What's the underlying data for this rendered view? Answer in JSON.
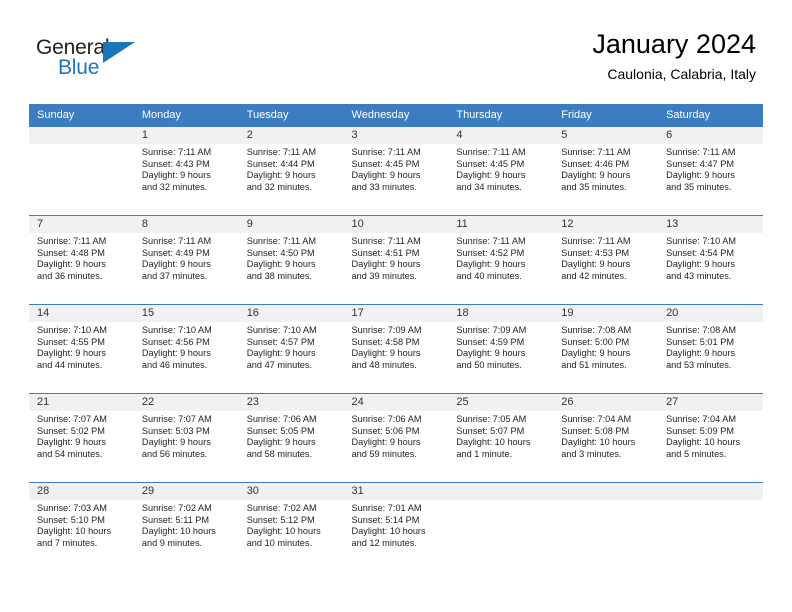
{
  "brand": {
    "name_part1": "General",
    "name_part2": "Blue",
    "accent_color": "#1b76bc"
  },
  "header": {
    "title": "January 2024",
    "subtitle": "Caulonia, Calabria, Italy"
  },
  "theme": {
    "header_band": "#3b7dc0",
    "daynum_band": "#f1f1f1",
    "text": "#231f20"
  },
  "weekdays": [
    "Sunday",
    "Monday",
    "Tuesday",
    "Wednesday",
    "Thursday",
    "Friday",
    "Saturday"
  ],
  "weeks": [
    [
      {
        "day": ""
      },
      {
        "day": "1",
        "sunrise": "Sunrise: 7:11 AM",
        "sunset": "Sunset: 4:43 PM",
        "daylight_1": "Daylight: 9 hours",
        "daylight_2": "and 32 minutes."
      },
      {
        "day": "2",
        "sunrise": "Sunrise: 7:11 AM",
        "sunset": "Sunset: 4:44 PM",
        "daylight_1": "Daylight: 9 hours",
        "daylight_2": "and 32 minutes."
      },
      {
        "day": "3",
        "sunrise": "Sunrise: 7:11 AM",
        "sunset": "Sunset: 4:45 PM",
        "daylight_1": "Daylight: 9 hours",
        "daylight_2": "and 33 minutes."
      },
      {
        "day": "4",
        "sunrise": "Sunrise: 7:11 AM",
        "sunset": "Sunset: 4:45 PM",
        "daylight_1": "Daylight: 9 hours",
        "daylight_2": "and 34 minutes."
      },
      {
        "day": "5",
        "sunrise": "Sunrise: 7:11 AM",
        "sunset": "Sunset: 4:46 PM",
        "daylight_1": "Daylight: 9 hours",
        "daylight_2": "and 35 minutes."
      },
      {
        "day": "6",
        "sunrise": "Sunrise: 7:11 AM",
        "sunset": "Sunset: 4:47 PM",
        "daylight_1": "Daylight: 9 hours",
        "daylight_2": "and 35 minutes."
      }
    ],
    [
      {
        "day": "7",
        "sunrise": "Sunrise: 7:11 AM",
        "sunset": "Sunset: 4:48 PM",
        "daylight_1": "Daylight: 9 hours",
        "daylight_2": "and 36 minutes."
      },
      {
        "day": "8",
        "sunrise": "Sunrise: 7:11 AM",
        "sunset": "Sunset: 4:49 PM",
        "daylight_1": "Daylight: 9 hours",
        "daylight_2": "and 37 minutes."
      },
      {
        "day": "9",
        "sunrise": "Sunrise: 7:11 AM",
        "sunset": "Sunset: 4:50 PM",
        "daylight_1": "Daylight: 9 hours",
        "daylight_2": "and 38 minutes."
      },
      {
        "day": "10",
        "sunrise": "Sunrise: 7:11 AM",
        "sunset": "Sunset: 4:51 PM",
        "daylight_1": "Daylight: 9 hours",
        "daylight_2": "and 39 minutes."
      },
      {
        "day": "11",
        "sunrise": "Sunrise: 7:11 AM",
        "sunset": "Sunset: 4:52 PM",
        "daylight_1": "Daylight: 9 hours",
        "daylight_2": "and 40 minutes."
      },
      {
        "day": "12",
        "sunrise": "Sunrise: 7:11 AM",
        "sunset": "Sunset: 4:53 PM",
        "daylight_1": "Daylight: 9 hours",
        "daylight_2": "and 42 minutes."
      },
      {
        "day": "13",
        "sunrise": "Sunrise: 7:10 AM",
        "sunset": "Sunset: 4:54 PM",
        "daylight_1": "Daylight: 9 hours",
        "daylight_2": "and 43 minutes."
      }
    ],
    [
      {
        "day": "14",
        "sunrise": "Sunrise: 7:10 AM",
        "sunset": "Sunset: 4:55 PM",
        "daylight_1": "Daylight: 9 hours",
        "daylight_2": "and 44 minutes."
      },
      {
        "day": "15",
        "sunrise": "Sunrise: 7:10 AM",
        "sunset": "Sunset: 4:56 PM",
        "daylight_1": "Daylight: 9 hours",
        "daylight_2": "and 46 minutes."
      },
      {
        "day": "16",
        "sunrise": "Sunrise: 7:10 AM",
        "sunset": "Sunset: 4:57 PM",
        "daylight_1": "Daylight: 9 hours",
        "daylight_2": "and 47 minutes."
      },
      {
        "day": "17",
        "sunrise": "Sunrise: 7:09 AM",
        "sunset": "Sunset: 4:58 PM",
        "daylight_1": "Daylight: 9 hours",
        "daylight_2": "and 48 minutes."
      },
      {
        "day": "18",
        "sunrise": "Sunrise: 7:09 AM",
        "sunset": "Sunset: 4:59 PM",
        "daylight_1": "Daylight: 9 hours",
        "daylight_2": "and 50 minutes."
      },
      {
        "day": "19",
        "sunrise": "Sunrise: 7:08 AM",
        "sunset": "Sunset: 5:00 PM",
        "daylight_1": "Daylight: 9 hours",
        "daylight_2": "and 51 minutes."
      },
      {
        "day": "20",
        "sunrise": "Sunrise: 7:08 AM",
        "sunset": "Sunset: 5:01 PM",
        "daylight_1": "Daylight: 9 hours",
        "daylight_2": "and 53 minutes."
      }
    ],
    [
      {
        "day": "21",
        "sunrise": "Sunrise: 7:07 AM",
        "sunset": "Sunset: 5:02 PM",
        "daylight_1": "Daylight: 9 hours",
        "daylight_2": "and 54 minutes."
      },
      {
        "day": "22",
        "sunrise": "Sunrise: 7:07 AM",
        "sunset": "Sunset: 5:03 PM",
        "daylight_1": "Daylight: 9 hours",
        "daylight_2": "and 56 minutes."
      },
      {
        "day": "23",
        "sunrise": "Sunrise: 7:06 AM",
        "sunset": "Sunset: 5:05 PM",
        "daylight_1": "Daylight: 9 hours",
        "daylight_2": "and 58 minutes."
      },
      {
        "day": "24",
        "sunrise": "Sunrise: 7:06 AM",
        "sunset": "Sunset: 5:06 PM",
        "daylight_1": "Daylight: 9 hours",
        "daylight_2": "and 59 minutes."
      },
      {
        "day": "25",
        "sunrise": "Sunrise: 7:05 AM",
        "sunset": "Sunset: 5:07 PM",
        "daylight_1": "Daylight: 10 hours",
        "daylight_2": "and 1 minute."
      },
      {
        "day": "26",
        "sunrise": "Sunrise: 7:04 AM",
        "sunset": "Sunset: 5:08 PM",
        "daylight_1": "Daylight: 10 hours",
        "daylight_2": "and 3 minutes."
      },
      {
        "day": "27",
        "sunrise": "Sunrise: 7:04 AM",
        "sunset": "Sunset: 5:09 PM",
        "daylight_1": "Daylight: 10 hours",
        "daylight_2": "and 5 minutes."
      }
    ],
    [
      {
        "day": "28",
        "sunrise": "Sunrise: 7:03 AM",
        "sunset": "Sunset: 5:10 PM",
        "daylight_1": "Daylight: 10 hours",
        "daylight_2": "and 7 minutes."
      },
      {
        "day": "29",
        "sunrise": "Sunrise: 7:02 AM",
        "sunset": "Sunset: 5:11 PM",
        "daylight_1": "Daylight: 10 hours",
        "daylight_2": "and 9 minutes."
      },
      {
        "day": "30",
        "sunrise": "Sunrise: 7:02 AM",
        "sunset": "Sunset: 5:12 PM",
        "daylight_1": "Daylight: 10 hours",
        "daylight_2": "and 10 minutes."
      },
      {
        "day": "31",
        "sunrise": "Sunrise: 7:01 AM",
        "sunset": "Sunset: 5:14 PM",
        "daylight_1": "Daylight: 10 hours",
        "daylight_2": "and 12 minutes."
      },
      {
        "day": ""
      },
      {
        "day": ""
      },
      {
        "day": ""
      }
    ]
  ]
}
